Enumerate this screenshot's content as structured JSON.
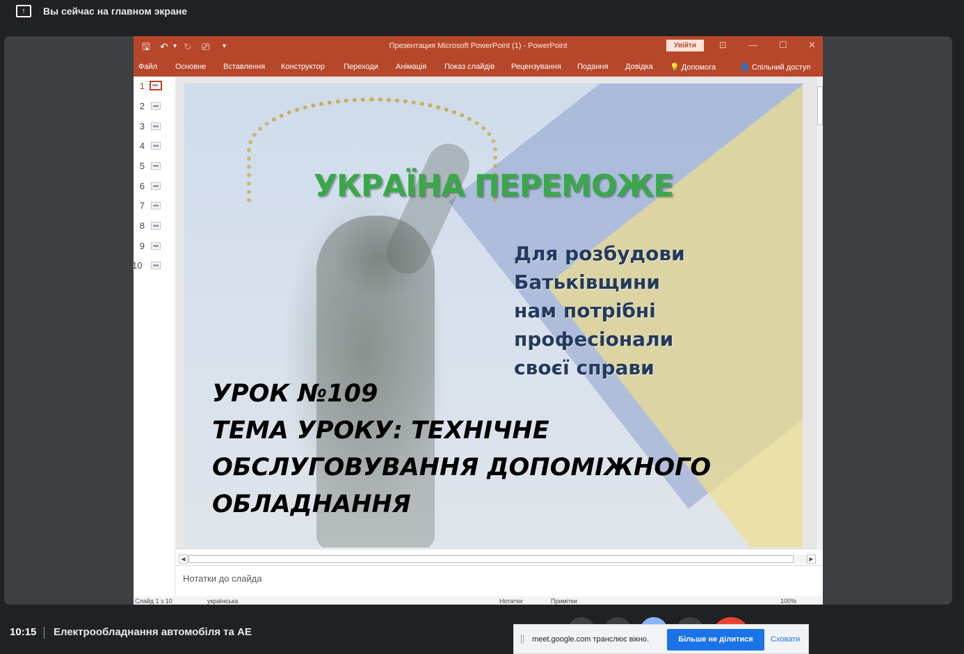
{
  "banner": {
    "icon": "share-screen-icon",
    "text": "Вы сейчас на главном экране"
  },
  "powerpoint": {
    "window_title": "Презентация Microsoft PowerPoint (1)  -  PowerPoint",
    "sign_in": "Увійти",
    "quick_access": {
      "save": "🖫",
      "undo": "↶",
      "undo_dd": "▾",
      "redo": "↻",
      "present": "⎚",
      "customize": "▾"
    },
    "window_controls": {
      "ribbon_options": "⊡",
      "minimize": "—",
      "maximize": "☐",
      "close": "✕"
    },
    "tabs": [
      "Файл",
      "Основне",
      "Вставлення",
      "Конструктор",
      "Переходи",
      "Анімація",
      "Показ слайдів",
      "Рецензування",
      "Подання",
      "Довідка"
    ],
    "help_search": "Допомога",
    "share": "Спільний доступ",
    "thumbnails": [
      "1",
      "2",
      "3",
      "4",
      "5",
      "6",
      "7",
      "8",
      "9",
      "10"
    ],
    "active_slide": 1,
    "slide": {
      "title": "УКРАЇНА ПЕРЕМОЖЕ",
      "subtitle": [
        "Для розбудови",
        "Батьківщини",
        "нам потрібні професіонали",
        "своєї справи"
      ],
      "lesson": [
        "УРОК №109",
        "ТЕМА УРОКУ: ТЕХНІЧНЕ",
        "ОБСЛУГОВУВАННЯ  ДОПОМІЖНОГО",
        "ОБЛАДНАННЯ"
      ]
    },
    "notes_placeholder": "Нотатки до слайда",
    "status": {
      "slide_counter": "Слайд 1 з 10",
      "language": "українська",
      "notes": "Нотатки",
      "comments": "Примітки",
      "zoom": "100%"
    },
    "colors": {
      "accent": "#b7472a",
      "title_green": "#3aa84a",
      "subtitle_navy": "#243a5e"
    }
  },
  "meet": {
    "time": "10:15",
    "meeting_name": "Електрообладнання автомобіля та АЕ",
    "share_notice": "meet.google.com транслює вікно.",
    "stop_sharing": "Більше не ділитися",
    "hide": "Сховати"
  }
}
